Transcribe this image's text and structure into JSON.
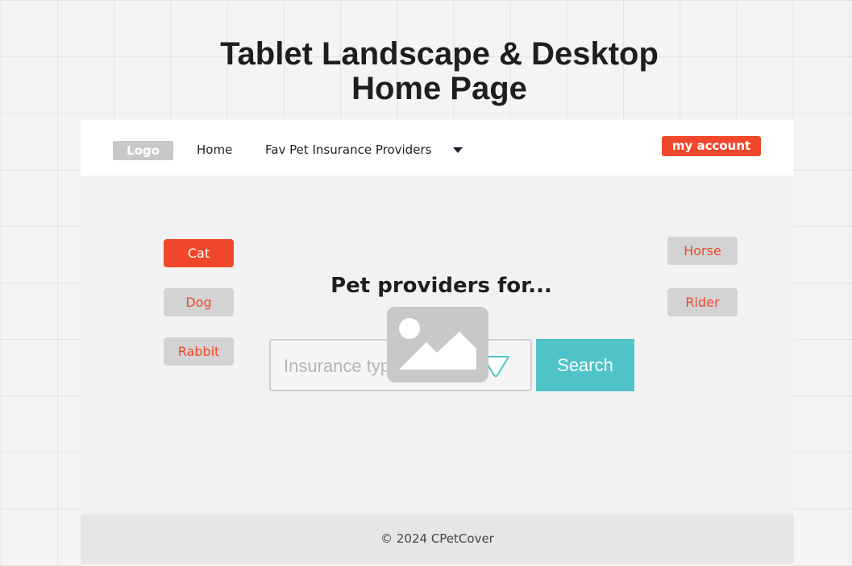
{
  "board": {
    "title": "Tablet Landscape & Desktop\nHome Page"
  },
  "navbar": {
    "logo": "Logo",
    "links": [
      "Home",
      "Fav Pet Insurance Providers"
    ],
    "dropdown_icon": "caret-down-icon",
    "account_button": "my account"
  },
  "pets": {
    "left": [
      "Cat",
      "Dog",
      "Rabbit"
    ],
    "right": [
      "Horse",
      "Rider"
    ],
    "selected": "Cat"
  },
  "search": {
    "heading": "Pet providers for...",
    "placeholder": "Insurance type",
    "dropdown_icon": "chevron-triangle-down-icon",
    "button": "Search",
    "image_icon": "image-placeholder-icon"
  },
  "footer": {
    "copyright": "© 2024 CPetCover"
  },
  "colors": {
    "accent": "#f0472a",
    "search_button": "#4fc3c8",
    "chip": "#d3d3d3",
    "frame_bg": "#f2f2f2",
    "footer_bg": "#e6e6e6"
  }
}
